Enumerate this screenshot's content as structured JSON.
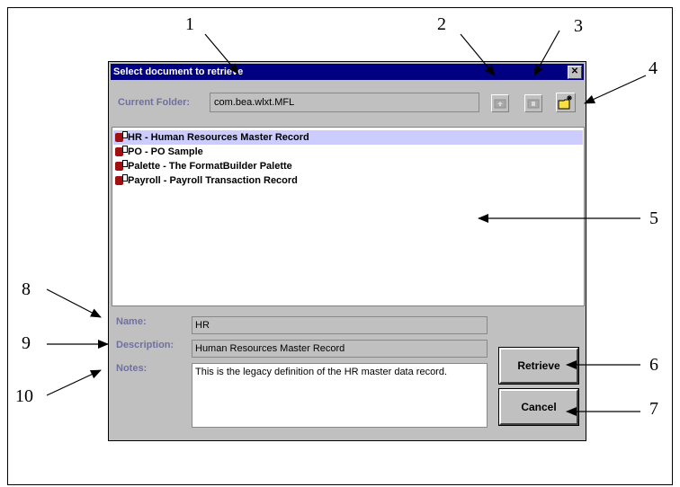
{
  "dialog": {
    "title": "Select document to retrieve",
    "close_glyph": "✕",
    "current_folder_label": "Current Folder:",
    "current_folder_value": "com.bea.wlxt.MFL",
    "toolbar_icons": [
      "folder-up-icon",
      "folder-open-icon",
      "new-folder-icon"
    ],
    "documents": [
      {
        "label": "HR - Human Resources Master Record",
        "selected": true
      },
      {
        "label": "PO - PO Sample",
        "selected": false
      },
      {
        "label": "Palette - The FormatBuilder Palette",
        "selected": false
      },
      {
        "label": "Payroll - Payroll Transaction Record",
        "selected": false
      }
    ],
    "name_label": "Name:",
    "name_value": "HR",
    "description_label": "Description:",
    "description_value": "Human Resources Master Record",
    "notes_label": "Notes:",
    "notes_value": "This is the legacy definition of the HR master data record.",
    "retrieve_label": "Retrieve",
    "cancel_label": "Cancel"
  },
  "callouts": [
    "1",
    "2",
    "3",
    "4",
    "5",
    "6",
    "7",
    "8",
    "9",
    "10"
  ],
  "colors": {
    "titlebar": "#000080",
    "selection": "#ccccff",
    "field_label": "#7070a0",
    "dialog_bg": "#c0c0c0"
  }
}
